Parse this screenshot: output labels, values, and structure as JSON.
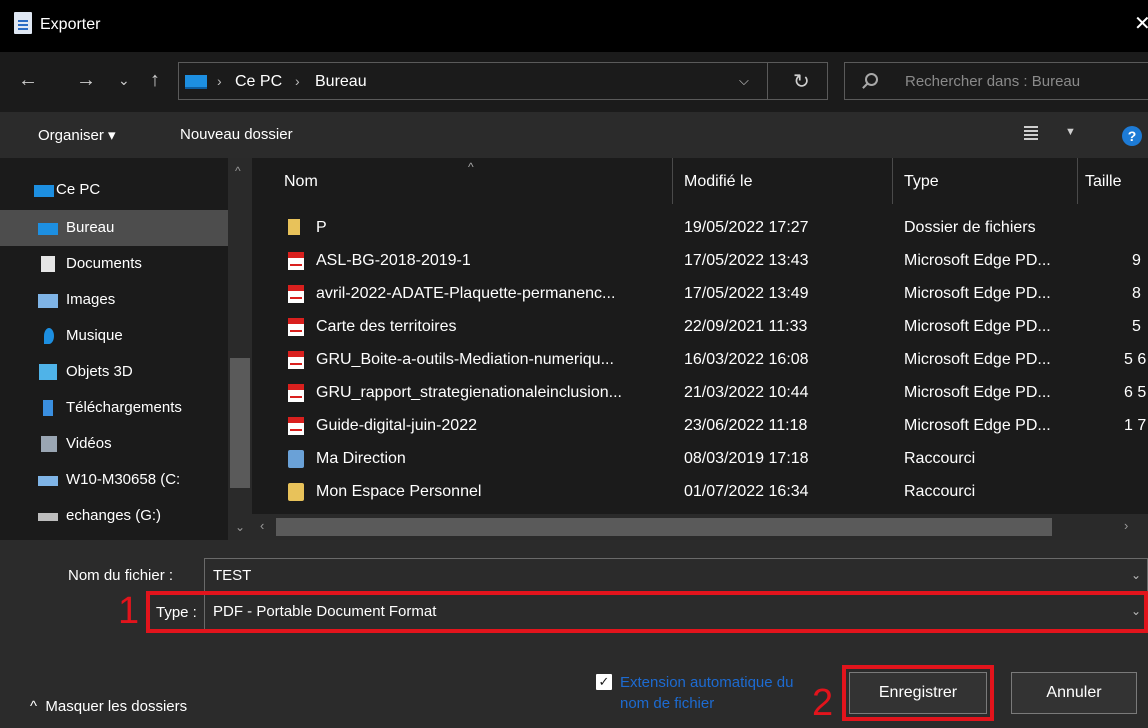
{
  "window": {
    "title": "Exporter",
    "close_glyph": "✕"
  },
  "nav": {
    "back": "←",
    "forward": "→",
    "recent": "⌄",
    "up": "↑"
  },
  "address": {
    "crumbs": [
      "Ce PC",
      "Bureau"
    ],
    "separator": "›",
    "dropdown": "⌵",
    "refresh": "↻"
  },
  "search": {
    "placeholder": "Rechercher dans : Bureau"
  },
  "commandbar": {
    "organize": "Organiser ▾",
    "new_folder": "Nouveau dossier",
    "view_dropdown": "▼",
    "help": "?"
  },
  "sidebar": {
    "items": [
      {
        "label": "Ce PC",
        "icon": "pc-icon"
      },
      {
        "label": "Bureau",
        "icon": "desktop-icon",
        "selected": true
      },
      {
        "label": "Documents",
        "icon": "documents-icon"
      },
      {
        "label": "Images",
        "icon": "images-icon"
      },
      {
        "label": "Musique",
        "icon": "music-icon"
      },
      {
        "label": "Objets 3D",
        "icon": "objects3d-icon"
      },
      {
        "label": "Téléchargements",
        "icon": "downloads-icon"
      },
      {
        "label": "Vidéos",
        "icon": "videos-icon"
      },
      {
        "label": "W10-M30658 (C:",
        "icon": "drive-icon"
      },
      {
        "label": "echanges (G:)",
        "icon": "network-drive-icon"
      }
    ]
  },
  "columns": {
    "name": "Nom",
    "modified": "Modifié le",
    "type": "Type",
    "size": "Taille"
  },
  "files": [
    {
      "name": "P",
      "modified": "19/05/2022 17:27",
      "type": "Dossier de fichiers",
      "size": "",
      "icon": "folder"
    },
    {
      "name": "ASL-BG-2018-2019-1",
      "modified": "17/05/2022 13:43",
      "type": "Microsoft Edge PD...",
      "size": "9",
      "icon": "pdf"
    },
    {
      "name": "avril-2022-ADATE-Plaquette-permanenc...",
      "modified": "17/05/2022 13:49",
      "type": "Microsoft Edge PD...",
      "size": "8",
      "icon": "pdf"
    },
    {
      "name": "Carte des territoires",
      "modified": "22/09/2021 11:33",
      "type": "Microsoft Edge PD...",
      "size": "5",
      "icon": "pdf"
    },
    {
      "name": "GRU_Boite-a-outils-Mediation-numeriqu...",
      "modified": "16/03/2022 16:08",
      "type": "Microsoft Edge PD...",
      "size": "5 6",
      "icon": "pdf"
    },
    {
      "name": "GRU_rapport_strategienationaleinclusion...",
      "modified": "21/03/2022 10:44",
      "type": "Microsoft Edge PD...",
      "size": "6 5",
      "icon": "pdf"
    },
    {
      "name": "Guide-digital-juin-2022",
      "modified": "23/06/2022 11:18",
      "type": "Microsoft Edge PD...",
      "size": "1 7",
      "icon": "pdf"
    },
    {
      "name": "Ma Direction",
      "modified": "08/03/2019 17:18",
      "type": "Raccourci",
      "size": "",
      "icon": "shortcut"
    },
    {
      "name": "Mon Espace Personnel",
      "modified": "01/07/2022 16:34",
      "type": "Raccourci",
      "size": "",
      "icon": "shortcut2"
    }
  ],
  "form": {
    "filename_label": "Nom du fichier :",
    "filename_value": "TEST",
    "type_label": "Type :",
    "type_value": "PDF - Portable Document Format",
    "auto_extension_label": "Extension automatique du nom de fichier",
    "auto_extension_checked": true
  },
  "buttons": {
    "save": "Enregistrer",
    "cancel": "Annuler",
    "hide_folders": "Masquer les dossiers"
  },
  "annotations": {
    "marker_1": "1",
    "marker_2": "2",
    "highlight_color": "#e2141c"
  }
}
